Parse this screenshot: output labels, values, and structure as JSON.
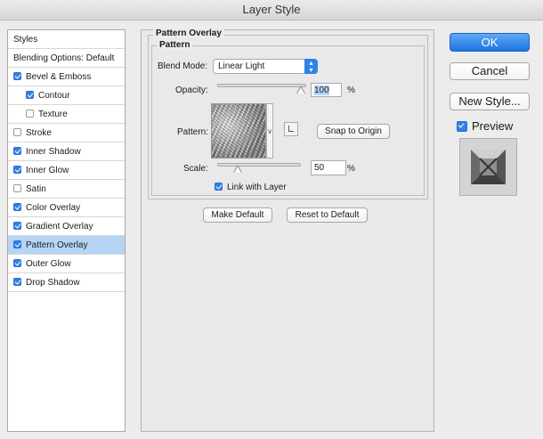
{
  "window": {
    "title": "Layer Style"
  },
  "sidebar": {
    "header": "Styles",
    "blending_options": "Blending Options: Default",
    "items": [
      {
        "label": "Bevel & Emboss",
        "checked": true
      },
      {
        "label": "Contour",
        "checked": true
      },
      {
        "label": "Texture",
        "checked": false
      },
      {
        "label": "Stroke",
        "checked": false
      },
      {
        "label": "Inner Shadow",
        "checked": true
      },
      {
        "label": "Inner Glow",
        "checked": true
      },
      {
        "label": "Satin",
        "checked": false
      },
      {
        "label": "Color Overlay",
        "checked": true
      },
      {
        "label": "Gradient Overlay",
        "checked": true
      },
      {
        "label": "Pattern Overlay",
        "checked": true,
        "selected": true
      },
      {
        "label": "Outer Glow",
        "checked": true
      },
      {
        "label": "Drop Shadow",
        "checked": true
      }
    ]
  },
  "pattern_overlay": {
    "section_title": "Pattern Overlay",
    "group_title": "Pattern",
    "blend_mode_label": "Blend Mode:",
    "blend_mode_value": "Linear Light",
    "opacity_label": "Opacity:",
    "opacity_value": "100",
    "opacity_unit": "%",
    "opacity_level": 1.0,
    "pattern_label": "Pattern:",
    "snap_button": "Snap to Origin",
    "scale_label": "Scale:",
    "scale_value": "50",
    "scale_unit": "%",
    "scale_level": 0.1,
    "link_label": "Link with Layer",
    "link_checked": true,
    "make_default_button": "Make Default",
    "reset_default_button": "Reset to Default"
  },
  "right": {
    "ok_button": "OK",
    "cancel_button": "Cancel",
    "new_style_button": "New Style...",
    "preview_label": "Preview",
    "preview_checked": true
  },
  "colors": {
    "accent": "#2e82e8",
    "selected_row": "#b5d5f7"
  },
  "icons": [
    "checkbox-icon",
    "dropdown-arrows-icon",
    "pattern-menu-arrow-icon",
    "new-preset-icon",
    "slider-thumb-icon"
  ]
}
